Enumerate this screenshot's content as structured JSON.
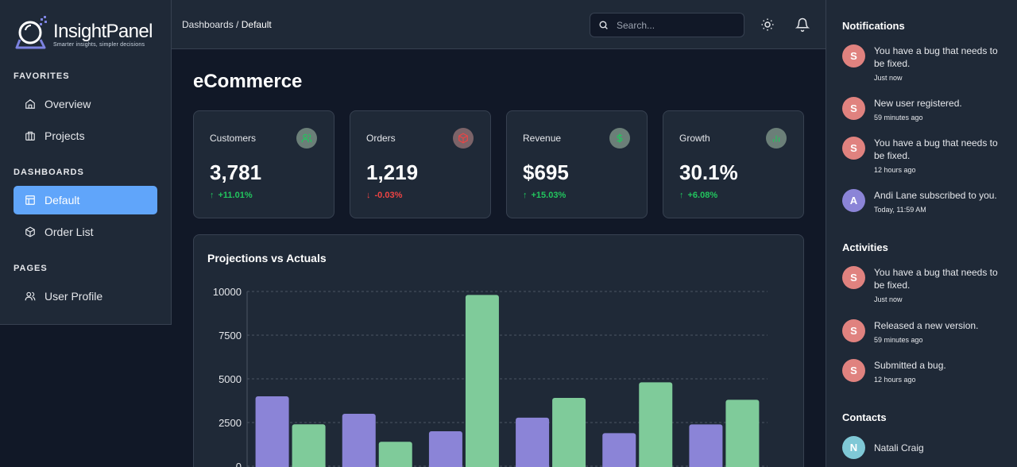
{
  "brand": {
    "name": "InsightPanel",
    "tagline": "Smarter insights, simpler decisions"
  },
  "sidebar": {
    "sections": [
      {
        "label": "FAVORITES",
        "items": [
          {
            "label": "Overview",
            "icon": "home-icon"
          },
          {
            "label": "Projects",
            "icon": "briefcase-icon"
          }
        ]
      },
      {
        "label": "DASHBOARDS",
        "items": [
          {
            "label": "Default",
            "icon": "layout-icon",
            "active": true
          },
          {
            "label": "Order List",
            "icon": "box-icon"
          }
        ]
      },
      {
        "label": "PAGES",
        "items": [
          {
            "label": "User Profile",
            "icon": "users-icon"
          }
        ]
      }
    ]
  },
  "header": {
    "breadcrumb": {
      "parent": "Dashboards",
      "separator": " / ",
      "current": "Default"
    },
    "search_placeholder": "Search...",
    "icons": [
      "search-icon",
      "sun-icon",
      "bell-icon"
    ]
  },
  "main": {
    "title": "eCommerce",
    "stats": [
      {
        "label": "Customers",
        "value": "3,781",
        "delta": "+11.01%",
        "trend": "up",
        "icon": "users-icon"
      },
      {
        "label": "Orders",
        "value": "1,219",
        "delta": "-0.03%",
        "trend": "down",
        "icon": "box-icon"
      },
      {
        "label": "Revenue",
        "value": "$695",
        "delta": "+15.03%",
        "trend": "up",
        "icon": "dollar-icon"
      },
      {
        "label": "Growth",
        "value": "30.1%",
        "delta": "+6.08%",
        "trend": "up",
        "icon": "bar-chart-icon"
      }
    ]
  },
  "colors": {
    "accent": "#60a5fa",
    "positive": "#22c55e",
    "negative": "#ef4444",
    "projection_bar": "#8b84d7",
    "actual_bar": "#7fcb9a"
  },
  "chart_data": {
    "type": "bar",
    "title": "Projections vs Actuals",
    "xlabel": "",
    "ylabel": "",
    "ylim": [
      0,
      10000
    ],
    "yticks": [
      0,
      2500,
      5000,
      7500,
      10000
    ],
    "grid": true,
    "categories": [
      "",
      "",
      "",
      "",
      "",
      ""
    ],
    "series": [
      {
        "values": [
          4000,
          3000,
          2000,
          2780,
          1890,
          2390
        ]
      },
      {
        "values": [
          2400,
          1398,
          9800,
          3908,
          4800,
          3800
        ]
      }
    ]
  },
  "notifications": {
    "title": "Notifications",
    "items": [
      {
        "initial": "S",
        "text": "You have a bug that needs to be fixed.",
        "time": "Just now"
      },
      {
        "initial": "S",
        "text": "New user registered.",
        "time": "59 minutes ago"
      },
      {
        "initial": "S",
        "text": "You have a bug that needs to be fixed.",
        "time": "12 hours ago"
      },
      {
        "initial": "A",
        "text": "Andi Lane subscribed to you.",
        "time": "Today, 11:59 AM"
      }
    ]
  },
  "activities": {
    "title": "Activities",
    "items": [
      {
        "initial": "S",
        "text": "You have a bug that needs to be fixed.",
        "time": "Just now"
      },
      {
        "initial": "S",
        "text": "Released a new version.",
        "time": "59 minutes ago"
      },
      {
        "initial": "S",
        "text": "Submitted a bug.",
        "time": "12 hours ago"
      }
    ]
  },
  "contacts": {
    "title": "Contacts",
    "items": [
      {
        "initial": "N",
        "name": "Natali Craig"
      }
    ]
  }
}
